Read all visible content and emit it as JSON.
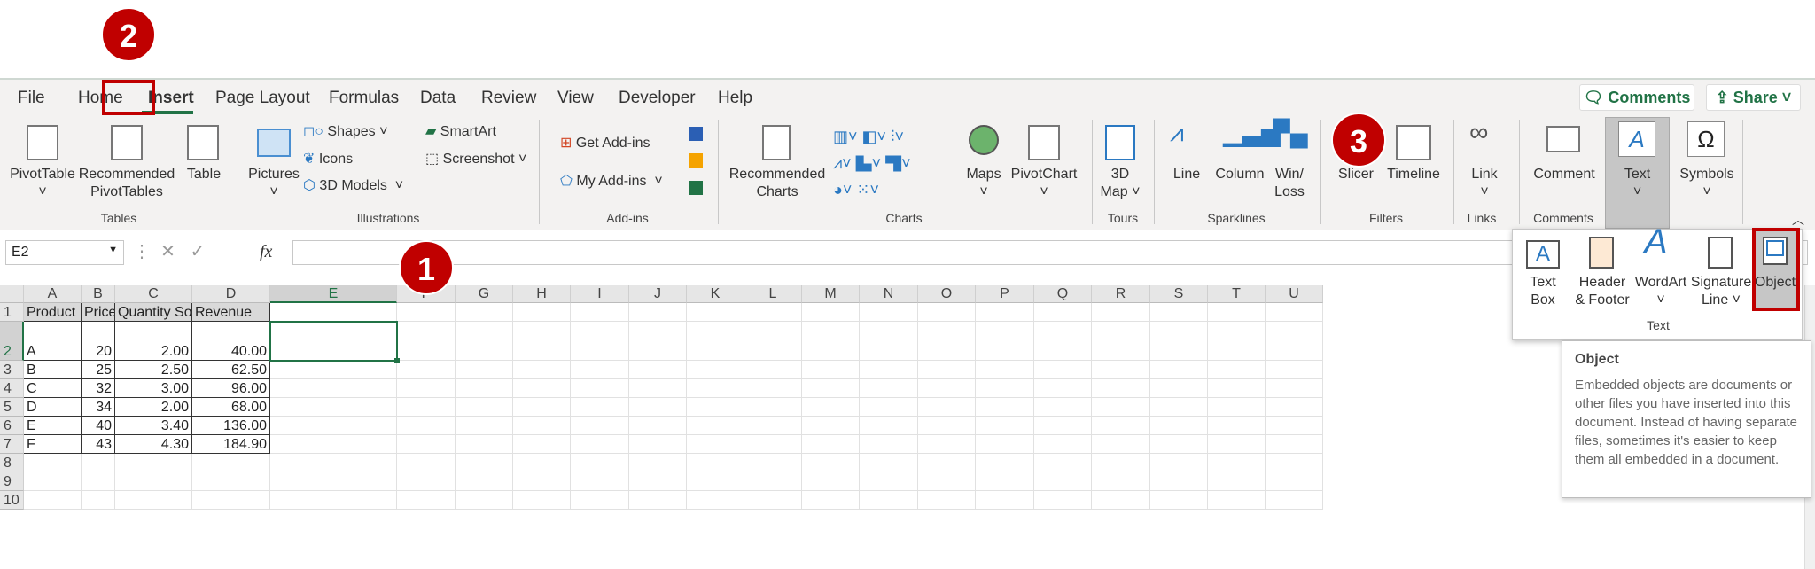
{
  "tabs": [
    "File",
    "Home",
    "Insert",
    "Page Layout",
    "Formulas",
    "Data",
    "Review",
    "View",
    "Developer",
    "Help"
  ],
  "active_tab": "Insert",
  "header_buttons": {
    "comments": "Comments",
    "share": "Share"
  },
  "ribbon": {
    "tables": {
      "label": "Tables",
      "pivottable": "PivotTable",
      "recommended": "Recommended",
      "pivottables": "PivotTables",
      "table": "Table"
    },
    "illustrations": {
      "label": "Illustrations",
      "pictures": "Pictures",
      "shapes": "Shapes",
      "icons": "Icons",
      "models": "3D Models",
      "smartart": "SmartArt",
      "screenshot": "Screenshot"
    },
    "addins": {
      "label": "Add-ins",
      "get": "Get Add-ins",
      "my": "My Add-ins"
    },
    "charts": {
      "label": "Charts",
      "recommended": "Recommended",
      "charts": "Charts",
      "maps": "Maps",
      "pivotchart": "PivotChart"
    },
    "tours": {
      "label": "Tours",
      "map1": "3D",
      "map2": "Map"
    },
    "sparklines": {
      "label": "Sparklines",
      "line": "Line",
      "column": "Column",
      "winloss1": "Win/",
      "winloss2": "Loss"
    },
    "filters": {
      "label": "Filters",
      "slicer": "Slicer",
      "timeline": "Timeline"
    },
    "links": {
      "label": "Links",
      "link": "Link"
    },
    "comments": {
      "label": "Comments",
      "comment": "Comment"
    },
    "text": {
      "label": "Text"
    },
    "symbols": {
      "label": "Symbols"
    }
  },
  "text_dropdown": {
    "textbox1": "Text",
    "textbox2": "Box",
    "header1": "Header",
    "header2": "& Footer",
    "wordart": "WordArt",
    "sig1": "Signature",
    "sig2": "Line",
    "object": "Object",
    "group": "Text"
  },
  "tooltip": {
    "title": "Object",
    "body": "Embedded objects are documents or other files you have inserted into this document. Instead of having separate files, sometimes it's easier to keep them all embedded in a document."
  },
  "formula_bar": {
    "name_box": "E2",
    "fx": "fx",
    "value": ""
  },
  "columns": [
    "A",
    "B",
    "C",
    "D",
    "E",
    "F",
    "G",
    "H",
    "I",
    "J",
    "K",
    "L",
    "M",
    "N",
    "O",
    "P",
    "Q",
    "R",
    "S",
    "T",
    "U"
  ],
  "rows": [
    "1",
    "2",
    "3",
    "4",
    "5",
    "6",
    "7",
    "8",
    "9",
    "10"
  ],
  "table": {
    "headers": [
      "Product",
      "Price",
      "Quantity Sold",
      "Revenue"
    ],
    "data": [
      [
        "A",
        "20",
        "2.00",
        "40.00"
      ],
      [
        "B",
        "25",
        "2.50",
        "62.50"
      ],
      [
        "C",
        "32",
        "3.00",
        "96.00"
      ],
      [
        "D",
        "34",
        "2.00",
        "68.00"
      ],
      [
        "E",
        "40",
        "3.40",
        "136.00"
      ],
      [
        "F",
        "43",
        "4.30",
        "184.90"
      ]
    ]
  },
  "callouts": [
    "1",
    "2",
    "3"
  ],
  "colors": {
    "accent": "#217346",
    "callout": "#c00000"
  }
}
